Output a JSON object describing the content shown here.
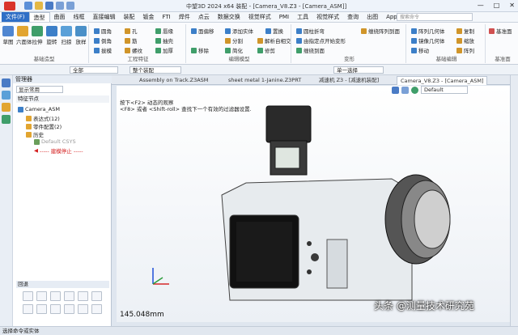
{
  "titlebar": {
    "title": "中望3D 2024 x64          装配 - [Camera_V8.Z3 - [Camera_ASM]]"
  },
  "menubar": {
    "file": "文件(F)",
    "tabs": [
      "造型",
      "曲面",
      "线框",
      "直接编辑",
      "装配",
      "钣金",
      "FTI",
      "焊件",
      "点云",
      "数据交换",
      "视觉样式",
      "PMI",
      "工具",
      "视觉样式",
      "查询",
      "出图",
      "App",
      "模具"
    ],
    "search_placeholder": "搜索命令"
  },
  "ribbon": {
    "groups": [
      {
        "name": "基础造型",
        "buttons": [
          "草图",
          "六面体",
          "拉伸",
          "旋转",
          "扫掠",
          "放样"
        ]
      },
      {
        "name": "工程特征",
        "buttons": [
          "圆角",
          "倒角",
          "拔模",
          "孔",
          "筋",
          "螺纹",
          "唇缘",
          "抽壳",
          "加厚"
        ]
      },
      {
        "name": "编辑模型",
        "buttons": [
          "面偏移",
          "添加实体",
          "置换",
          "分割",
          "解析自相交",
          "简化",
          "修剪",
          "移除"
        ]
      },
      {
        "name": "变形",
        "buttons": [
          "圆柱折弯",
          "由指定点开始变形",
          "缠绕阵列到面",
          "缠绕到面"
        ]
      },
      {
        "name": "基础编辑",
        "buttons": [
          "阵列几何体",
          "镜像几何体",
          "移动",
          "复制",
          "缩放",
          "阵列"
        ]
      },
      {
        "name": "基准面",
        "buttons": [
          "基准面"
        ]
      }
    ]
  },
  "toolbar2": {
    "filter": "全部",
    "assembly": "整个装配",
    "select": "单一选择"
  },
  "sidebar": {
    "header": "管理器",
    "filter": "显示常用",
    "feature_header": "特征节点",
    "tree": [
      "Camera_ASM",
      "表达式(12)",
      "零件配置(2)",
      "历史",
      "Default CSYS",
      "----- 建模停止 -----"
    ],
    "rollback": "回退"
  },
  "doctabs": [
    "Assembly on Track.Z3ASM",
    "sheet metal 1-Janine.Z3PRT",
    "减速机 Z3 - [减速机装配]",
    "Camera_V8.Z3 - [Camera_ASM]"
  ],
  "viewport": {
    "hint1": "按下<F2> 动态的观察",
    "hint2": "<F8> 或者 <Shift-roll> 查找下一个有效的过滤器设置.",
    "view": "Default",
    "measure": "145.048mm",
    "watermark": "头条 @测量技术研究苑"
  },
  "statusbar": {
    "text": "选择命令或实体"
  },
  "colors": {
    "accent": "#2f6fc6",
    "file_button": "#2f6fc6",
    "stop_text": "#d42020"
  }
}
